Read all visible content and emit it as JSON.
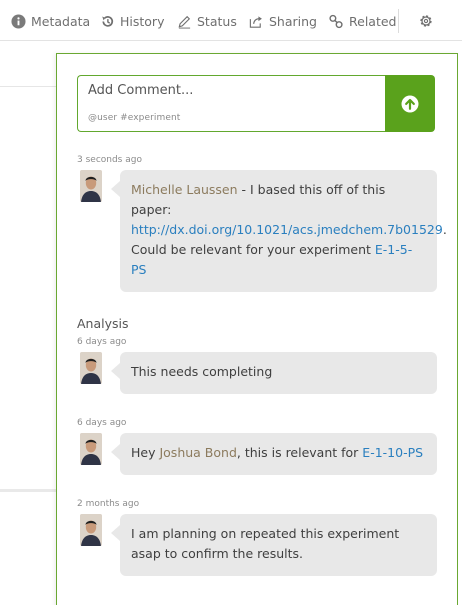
{
  "toolbar": {
    "metadata_label": "Metadata",
    "history_label": "History",
    "status_label": "Status",
    "sharing_label": "Sharing",
    "related_label": "Related"
  },
  "comment": {
    "placeholder": "Add Comment...",
    "hint": "@user  #experiment"
  },
  "thread": {
    "c1": {
      "time": "3 seconds ago",
      "author": "Michelle Laussen",
      "text_before": " - I based this off of this paper: ",
      "url_label": "http://dx.doi.org/10.1021/acs.jmedchem.7b01529",
      "text_after": ". Could be relevant for your experiment ",
      "ref": "E-1-5-PS"
    },
    "section": "Analysis",
    "c2": {
      "time": "6 days ago",
      "text": "This needs completing"
    },
    "c3": {
      "time": "6 days ago",
      "text_before": "Hey ",
      "mention": "Joshua Bond",
      "text_after": ", this is relevant for ",
      "ref": "E-1-10-PS"
    },
    "c4": {
      "time": "2 months ago",
      "text": "I am planning on repeated this experiment asap to confirm the results."
    }
  },
  "colors": {
    "accent": "#5aa21c",
    "link": "#2a7fbf",
    "author": "#8c7b5e"
  },
  "icons": [
    "info-icon",
    "history-icon",
    "pencil-icon",
    "share-icon",
    "related-icon",
    "gear-icon",
    "arrow-up-icon"
  ]
}
